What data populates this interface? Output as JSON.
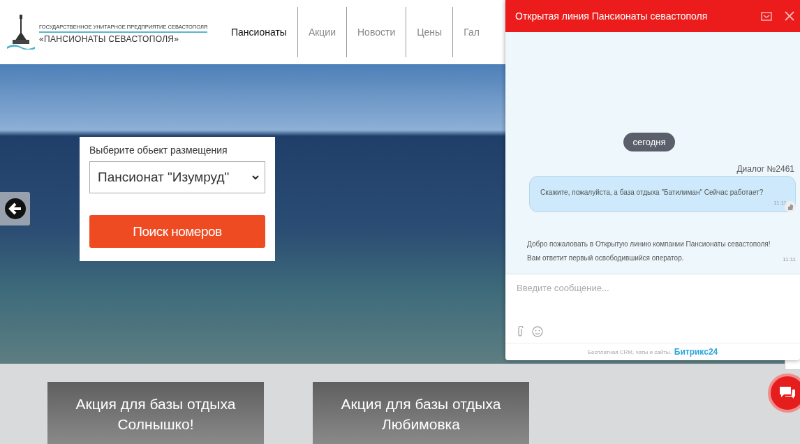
{
  "header": {
    "logo": {
      "line1": "ГОСУДАРСТВЕННОЕ УНИТАРНОЕ ПРЕДПРИЯТИЕ СЕВАСТОПОЛЯ",
      "line2": "«ПАНСИОНАТЫ СЕВАСТОПОЛЯ»"
    },
    "nav": [
      {
        "label": "Пансионаты",
        "selected": true
      },
      {
        "label": "Акции",
        "selected": false
      },
      {
        "label": "Новости",
        "selected": false
      },
      {
        "label": "Цены",
        "selected": false
      },
      {
        "label": "Гал",
        "selected": false
      }
    ]
  },
  "booking": {
    "label": "Выберите обьект размещения",
    "select_value": "Пансионат \"Изумруд\"",
    "button": "Поиск номеров"
  },
  "promos": [
    {
      "title": "Акция для базы отдыха\nСолнышко!"
    },
    {
      "title": "Акция для базы отдыха\nЛюбимовка"
    }
  ],
  "chat": {
    "title": "Открытая линия Пансионаты севастополя",
    "messages": [
      {
        "kind": "date",
        "text": "сегодня"
      },
      {
        "kind": "label",
        "text": "Диалог №2461"
      },
      {
        "kind": "user",
        "text": "Скажите, пожалуйста, а база отдыха \"Батилиман\" Сейчас работает?",
        "time": "11:11"
      },
      {
        "kind": "system",
        "text": "Добро пожаловать в Открытую линию компании Пансионаты севастополя!\nВам ответит первый освободившийся оператор.",
        "time": "11:11"
      }
    ],
    "input": {
      "placeholder": "Введите сообщение..."
    },
    "footer": {
      "text": "Бесплатная CRM, чаты и сайты.",
      "brand": "Битрикс24"
    }
  }
}
